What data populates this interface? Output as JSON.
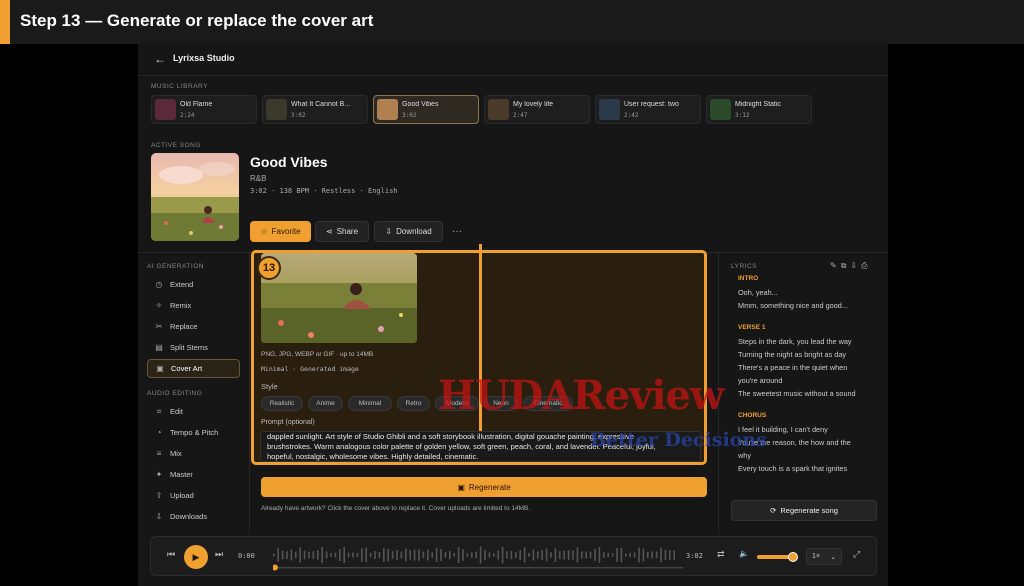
{
  "step_title": "Step 13 — Generate or replace the cover art",
  "header": {
    "back": "←",
    "app_name": "Lyrixsa Studio"
  },
  "library": {
    "label": "MUSIC LIBRARY",
    "songs": [
      {
        "name": "Old Flame",
        "time": "2:24",
        "color": "#5a2a3a"
      },
      {
        "name": "What It Cannot B...",
        "time": "3:02",
        "color": "#3a3a2a"
      },
      {
        "name": "Good Vibes",
        "time": "3:02",
        "color": "#b08050"
      },
      {
        "name": "My lovely life",
        "time": "2:47",
        "color": "#4a3a2a"
      },
      {
        "name": "User request: two",
        "time": "2:42",
        "color": "#2a3a4a"
      },
      {
        "name": "Midnight Static",
        "time": "3:12",
        "color": "#2a4a2a"
      }
    ]
  },
  "active": {
    "label": "ACTIVE SONG",
    "title": "Good Vibes",
    "genre": "R&B",
    "meta": "3:02 · 138 BPM · Restless · English",
    "favorite": "Favorite",
    "share": "Share",
    "download": "Download",
    "more": "···"
  },
  "sidebar": {
    "ai_label": "AI GENERATION",
    "ai_items": [
      {
        "icon": "◷",
        "label": "Extend"
      },
      {
        "icon": "✧",
        "label": "Remix"
      },
      {
        "icon": "✂",
        "label": "Replace"
      },
      {
        "icon": "▤",
        "label": "Split Stems"
      },
      {
        "icon": "▣",
        "label": "Cover Art"
      }
    ],
    "edit_label": "AUDIO EDITING",
    "edit_items": [
      {
        "icon": "⌗",
        "label": "Edit"
      },
      {
        "icon": "◔",
        "label": "Tempo & Pitch"
      },
      {
        "icon": "≡",
        "label": "Mix"
      },
      {
        "icon": "✦",
        "label": "Master"
      },
      {
        "icon": "⇧",
        "label": "Upload"
      },
      {
        "icon": "⇩",
        "label": "Downloads"
      }
    ]
  },
  "cover_art": {
    "badge": "13",
    "formats": "PNG, JPG, WEBP or GIF · up to 14MB",
    "status": "Minimal · Generated image",
    "style_label": "Style",
    "styles": [
      "Realistic",
      "Anime",
      "Minimal",
      "Retro",
      "Modern",
      "Neon",
      "Cinematic"
    ],
    "prompt_label": "Prompt (optional)",
    "prompt_lines": [
      "dappled sunlight. Art style of Studio Ghibli and a soft storybook illustration, digital gouache painting, expressive",
      "brushstrokes. Warm analogous color palette of golden yellow, soft green, peach, coral, and lavender. Peaceful, joyful,",
      "hopeful, nostalgic, wholesome vibes. Highly detailed, cinematic."
    ],
    "regenerate": "Regenerate",
    "footnote": "Already have artwork? Click the cover above to replace it. Cover uploads are limited to 14MB."
  },
  "lyrics": {
    "label": "LYRICS",
    "tools": "✎⧉⇩⎙",
    "lines": [
      {
        "text": "INTRO",
        "sect": true
      },
      {
        "text": "Ooh, yeah...",
        "sect": false
      },
      {
        "text": "Mmm, something nice and good...",
        "sect": false
      },
      {
        "text": "VERSE 1",
        "sect": true
      },
      {
        "text": "Steps in the dark, you lead the way",
        "sect": false
      },
      {
        "text": "Turning the night as bright as day",
        "sect": false
      },
      {
        "text": "There's a peace in the quiet when",
        "sect": false
      },
      {
        "text": "you're around",
        "sect": false
      },
      {
        "text": "The sweetest music without a sound",
        "sect": false
      },
      {
        "text": "CHORUS",
        "sect": true
      },
      {
        "text": "I feel it building, I can't deny",
        "sect": false
      },
      {
        "text": "You're the reason, the how and the",
        "sect": false
      },
      {
        "text": "why",
        "sect": false
      },
      {
        "text": "Every touch is a spark that ignites",
        "sect": false
      }
    ],
    "regenerate_song": "Regenerate song"
  },
  "player": {
    "prev": "⏮",
    "play": "▶",
    "next": "⏭",
    "current": "0:00",
    "total": "3:02",
    "repeat": "⇄",
    "volume_icon": "🔈",
    "volume_level": 0.85,
    "speed": "1×",
    "speed_caret": "⌄",
    "expand": "⤢"
  },
  "watermark": {
    "brand": "HUDAReview",
    "tagline": "Better Decisions"
  },
  "colors": {
    "accent": "#f0a030",
    "panel": "#161616"
  }
}
